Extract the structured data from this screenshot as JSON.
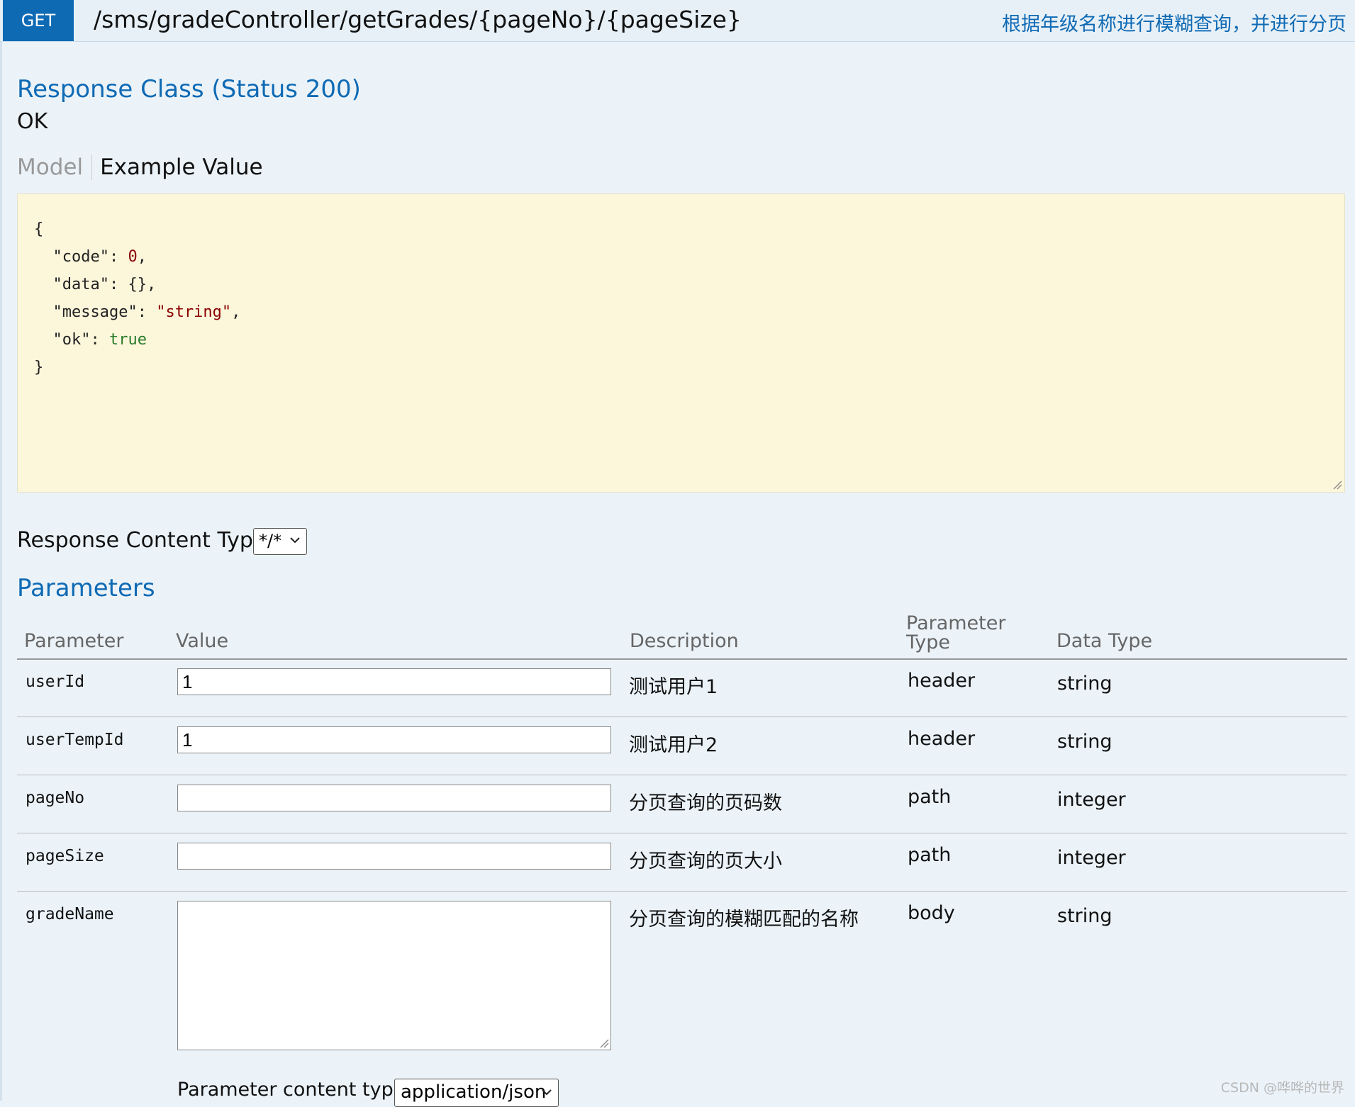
{
  "operation": {
    "method": "GET",
    "path": "/sms/gradeController/getGrades/{pageNo}/{pageSize}",
    "summary": "根据年级名称进行模糊查询，并进行分页"
  },
  "response": {
    "heading": "Response Class (Status 200)",
    "status_text": "OK",
    "tabs": {
      "model": "Model",
      "example": "Example Value"
    },
    "example_lines": [
      "{",
      "\"code\": ",
      "0",
      "\"data\": {}",
      "\"message\": ",
      "\"string\"",
      "\"ok\": ",
      "true",
      "}"
    ]
  },
  "response_content_type": {
    "label": "Response Content Type",
    "selected": "*/*"
  },
  "parameters": {
    "heading": "Parameters",
    "columns": {
      "parameter": "Parameter",
      "value": "Value",
      "description": "Description",
      "parameter_type_1": "Parameter",
      "parameter_type_2": "Type",
      "data_type": "Data Type"
    },
    "rows": [
      {
        "name": "userId",
        "value": "1",
        "description": "测试用户1",
        "param_type": "header",
        "data_type": "string"
      },
      {
        "name": "userTempId",
        "value": "1",
        "description": "测试用户2",
        "param_type": "header",
        "data_type": "string"
      },
      {
        "name": "pageNo",
        "value": "",
        "description": "分页查询的页码数",
        "param_type": "path",
        "data_type": "integer"
      },
      {
        "name": "pageSize",
        "value": "",
        "description": "分页查询的页大小",
        "param_type": "path",
        "data_type": "integer"
      },
      {
        "name": "gradeName",
        "value": "",
        "description": "分页查询的模糊匹配的名称",
        "param_type": "body",
        "data_type": "string"
      }
    ],
    "content_type_label": "Parameter content type:",
    "content_type_selected": "application/json"
  },
  "watermark": "CSDN @哗哗的世界",
  "colors": {
    "method_badge": "#0f6ab4",
    "link_blue": "#0f6ab4",
    "example_bg": "#fcf6db",
    "page_bg": "#ebf3f9"
  }
}
